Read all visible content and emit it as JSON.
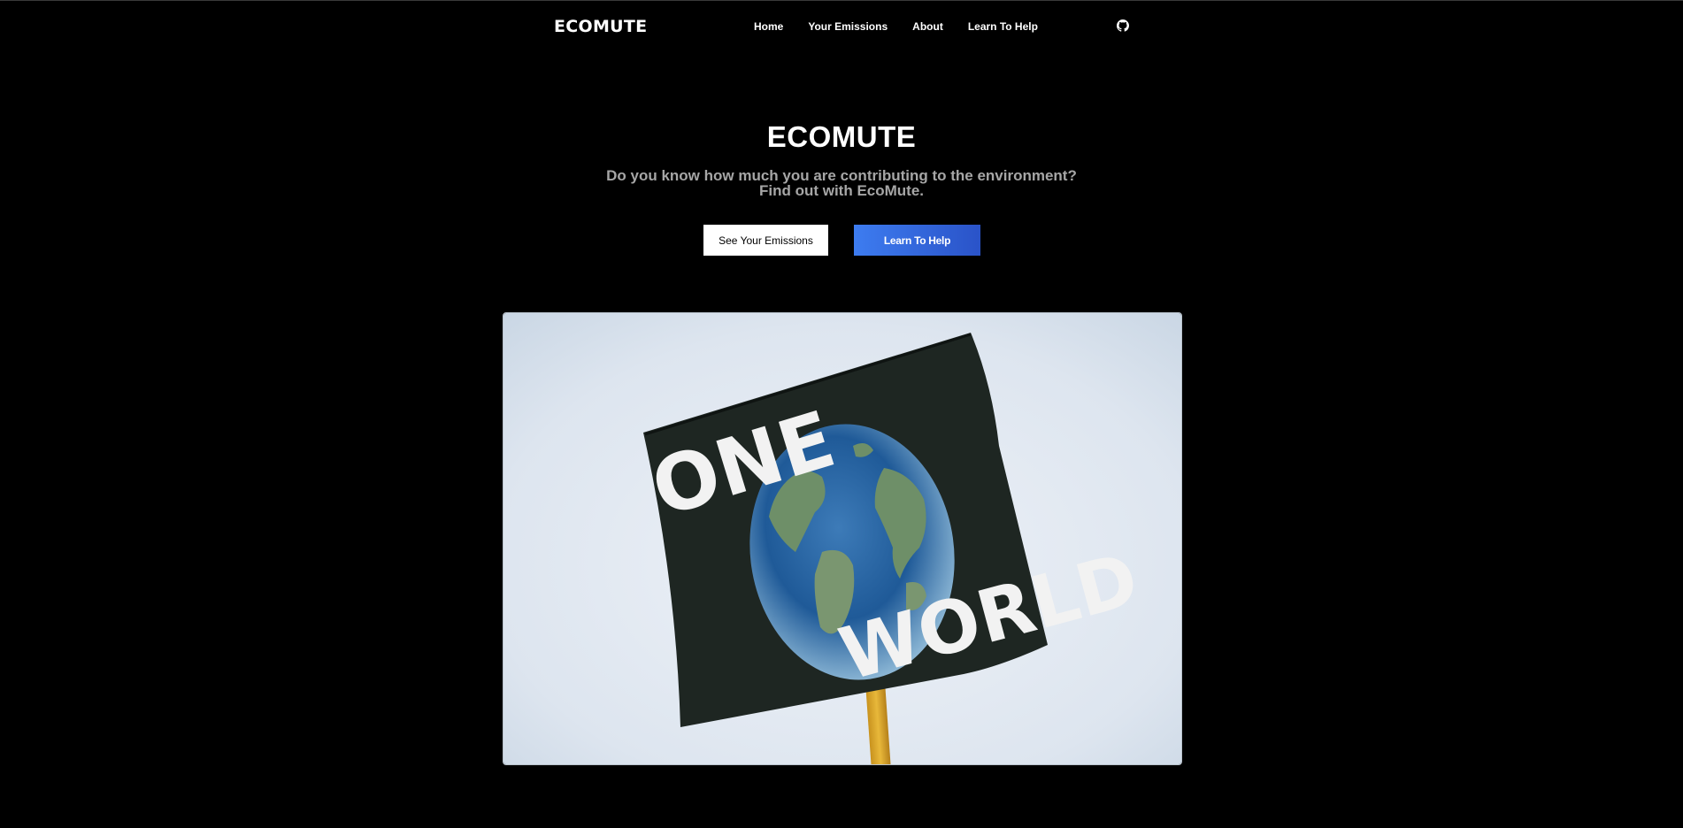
{
  "nav": {
    "brand": "ECOMUTE",
    "links": [
      {
        "label": "Home"
      },
      {
        "label": "Your Emissions"
      },
      {
        "label": "About"
      },
      {
        "label": "Learn To Help"
      }
    ],
    "github_icon": "github-icon"
  },
  "hero": {
    "title": "ECOMUTE",
    "subtitle_line1": "Do you know how much you are contributing to the environment?",
    "subtitle_line2": "Find out with EcoMute.",
    "primary_button": "See Your Emissions",
    "secondary_button": "Learn To Help",
    "image": {
      "word_top": "ONE",
      "word_bottom": "WORLD"
    }
  },
  "colors": {
    "background": "#000000",
    "subtitle": "#a6a6a6",
    "accent_start": "#3d7cf0",
    "accent_end": "#2a53c8"
  }
}
